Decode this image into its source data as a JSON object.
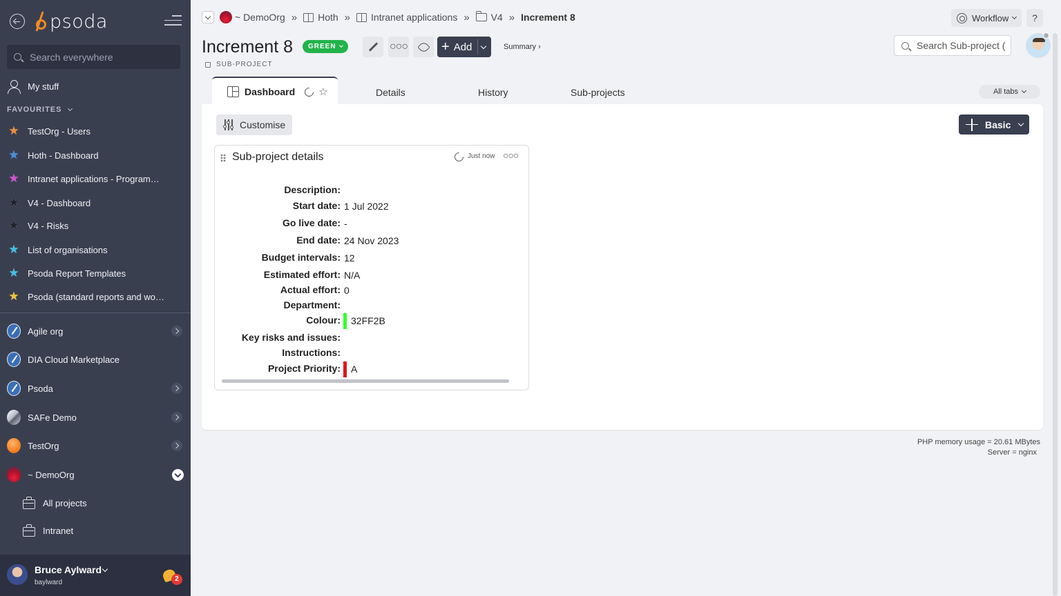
{
  "sidebar": {
    "logo_text": "psoda",
    "search_placeholder": "Search everywhere",
    "my_stuff": "My stuff",
    "favourites_heading": "FAVOURITES",
    "favourites": [
      {
        "label": "TestOrg - Users",
        "color": "#f28c3a"
      },
      {
        "label": "Hoth - Dashboard",
        "color": "#4a8fe0"
      },
      {
        "label": "Intranet applications - Programme Dashboard",
        "color": "#d64fd6"
      },
      {
        "label": "V4 - Dashboard",
        "color": "#1f222b"
      },
      {
        "label": "V4 - Risks",
        "color": "#1f222b"
      },
      {
        "label": "List of organisations",
        "color": "#3ec2e6"
      },
      {
        "label": "Psoda Report Templates",
        "color": "#3ec2e6"
      },
      {
        "label": "Psoda (standard reports and workflows)",
        "color": "#f2c63a"
      }
    ],
    "orgs": [
      {
        "label": "Agile org",
        "expandable": true
      },
      {
        "label": "DIA Cloud Marketplace",
        "expandable": false
      },
      {
        "label": "Psoda",
        "expandable": true
      },
      {
        "label": "SAFe Demo",
        "expandable": true
      },
      {
        "label": "TestOrg",
        "expandable": true
      },
      {
        "label": "~ DemoOrg",
        "expanded": true
      }
    ],
    "sub_items": [
      "All projects",
      "Intranet"
    ],
    "user": {
      "name": "Bruce Aylward",
      "username": "baylward",
      "notifications": "2"
    }
  },
  "breadcrumb": {
    "items": [
      "~ DemoOrg",
      "Hoth",
      "Intranet applications",
      "V4"
    ],
    "current": "Increment 8"
  },
  "header": {
    "workflow_label": "Workflow",
    "help_label": "?",
    "title": "Increment 8",
    "status": "GREEN",
    "status_color": "#23b34b",
    "type_label": "SUB-PROJECT",
    "add_label": "Add",
    "summary_label": "Summary ›",
    "search_placeholder": "Search Sub-project (",
    "accent_color": "#3a3f50"
  },
  "tabs": {
    "active": "Dashboard",
    "items": [
      "Details",
      "History",
      "Sub-projects"
    ],
    "all_tabs_label": "All tabs"
  },
  "dashboard": {
    "customise_label": "Customise",
    "layout_label": "Basic",
    "widget": {
      "title": "Sub-project details",
      "refreshed": "Just now",
      "fields": [
        {
          "label": "Description:",
          "value": ""
        },
        {
          "label": "Start date:",
          "value": "1 Jul 2022"
        },
        {
          "label": "Go live date:",
          "value": "-"
        },
        {
          "label": "End date:",
          "value": "24 Nov 2023"
        },
        {
          "label": "Budget intervals:",
          "value": "12"
        },
        {
          "label": "Estimated effort:",
          "value": "N/A"
        },
        {
          "label": "Actual effort:",
          "value": "0"
        },
        {
          "label": "Department:",
          "value": ""
        },
        {
          "label": "Colour:",
          "value": "32FF2B",
          "swatch": "#32ff2b"
        },
        {
          "label": "Key risks and issues:",
          "value": ""
        },
        {
          "label": "Instructions:",
          "value": ""
        },
        {
          "label": "Project Priority:",
          "value": "A",
          "swatch": "#e0141e"
        }
      ]
    }
  },
  "footer": {
    "memory": "PHP memory usage = 20.61 MBytes",
    "server": "Server = nginx"
  }
}
